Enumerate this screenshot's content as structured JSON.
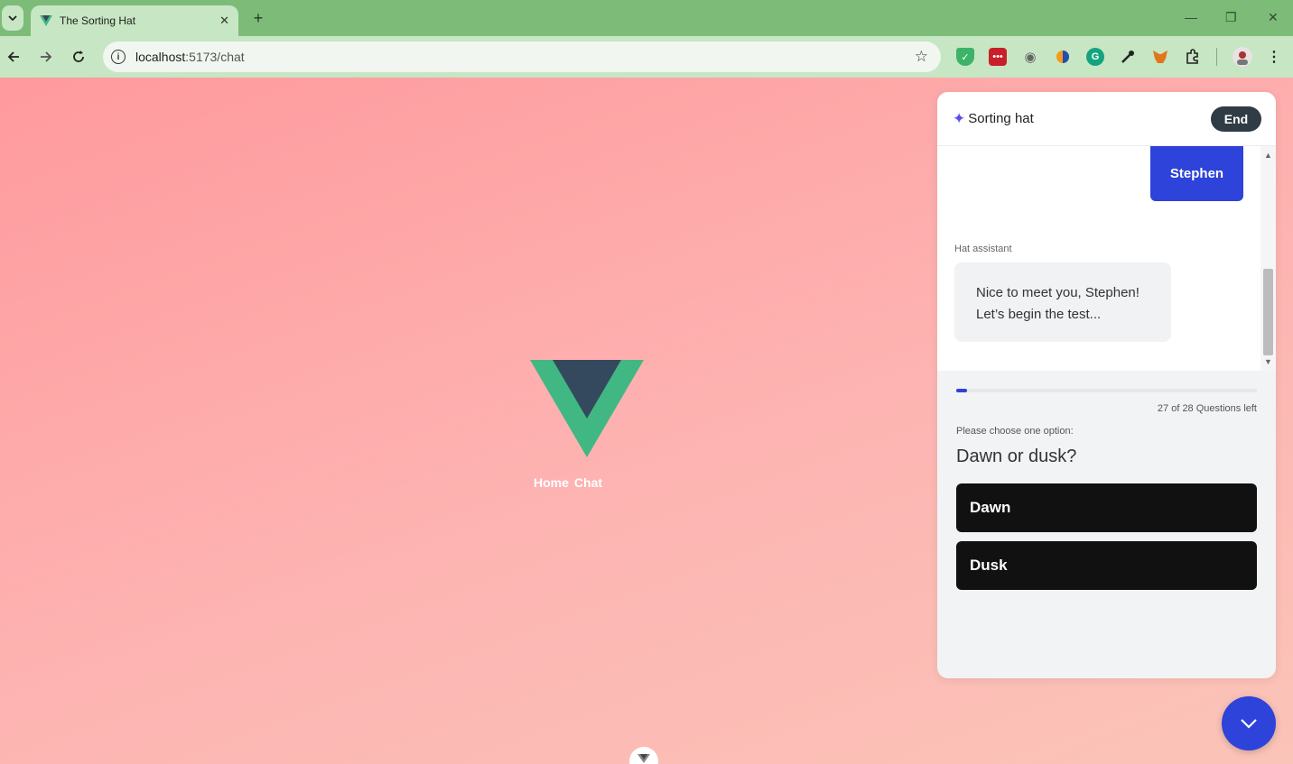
{
  "browser": {
    "tab_title": "The Sorting Hat",
    "tab_close": "✕",
    "new_tab": "+",
    "url_host": "localhost",
    "url_path": ":5173/chat",
    "info_glyph": "i",
    "window_controls": {
      "minimize": "—",
      "restore": "❐",
      "close": "✕"
    },
    "extensions": [
      "shield-extension",
      "camera-extension",
      "half-circle-extension",
      "grammarly-extension",
      "dropper-extension",
      "metamask-extension",
      "puzzle-extension"
    ]
  },
  "page": {
    "nav_home": "Home",
    "nav_chat": "Chat",
    "background_colors": [
      "#ff9a9e",
      "#fbc4b8"
    ]
  },
  "chat": {
    "title": "Sorting hat",
    "end_button": "End",
    "user_message": "Stephen",
    "assistant_label": "Hat assistant",
    "assistant_message_line1": "Nice to meet you, Stephen!",
    "assistant_message_line2": "Let’s begin the test...",
    "progress_fraction": 0.036,
    "questions_left": "27 of 28 Questions left",
    "prompt": "Please choose one option:",
    "question": "Dawn or dusk?",
    "options": [
      "Dawn",
      "Dusk"
    ],
    "accent_color": "#2d43d9"
  }
}
